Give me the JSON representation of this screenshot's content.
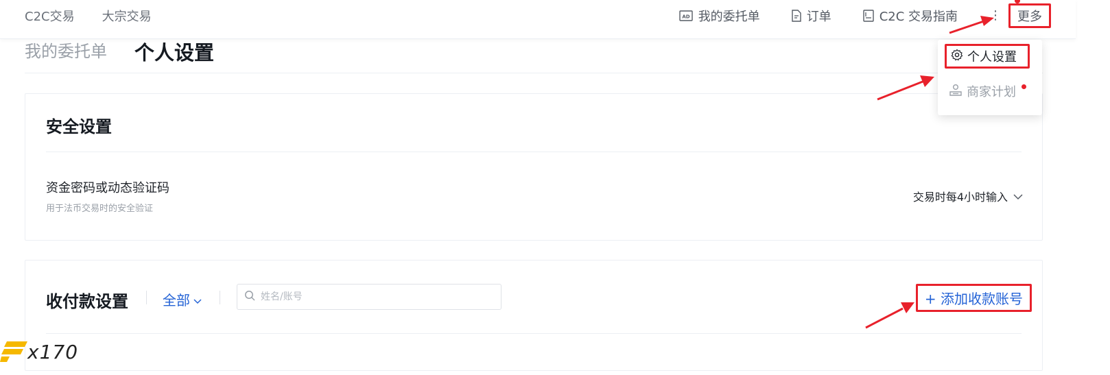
{
  "nav": {
    "left_items": [
      "C2C交易",
      "大宗交易"
    ],
    "right_items": [
      {
        "label": "我的委托单",
        "icon": "ad-icon"
      },
      {
        "label": "订单",
        "icon": "document-icon"
      },
      {
        "label": "C2C 交易指南",
        "icon": "book-icon"
      }
    ],
    "kebab": "⋮",
    "more_label": "更多"
  },
  "tabs": [
    "我的委托单",
    "个人设置"
  ],
  "dropdown": {
    "items": [
      {
        "label": "个人设置",
        "icon": "gear-icon"
      },
      {
        "label": "商家计划",
        "icon": "merchant-icon"
      }
    ]
  },
  "security": {
    "title": "安全设置",
    "row_title": "资金密码或动态验证码",
    "row_subtitle": "用于法币交易时的安全验证",
    "select_value": "交易时每4小时输入"
  },
  "payment": {
    "title": "收付款设置",
    "filter_label": "全部",
    "search_placeholder": "姓名/账号",
    "add_button": "+ 添加收款账号"
  },
  "watermark": {
    "text": "x170"
  },
  "colors": {
    "accent": "#2463d6",
    "highlight": "#e8212b",
    "text": "#1f2329",
    "muted": "#9aa0a8"
  }
}
